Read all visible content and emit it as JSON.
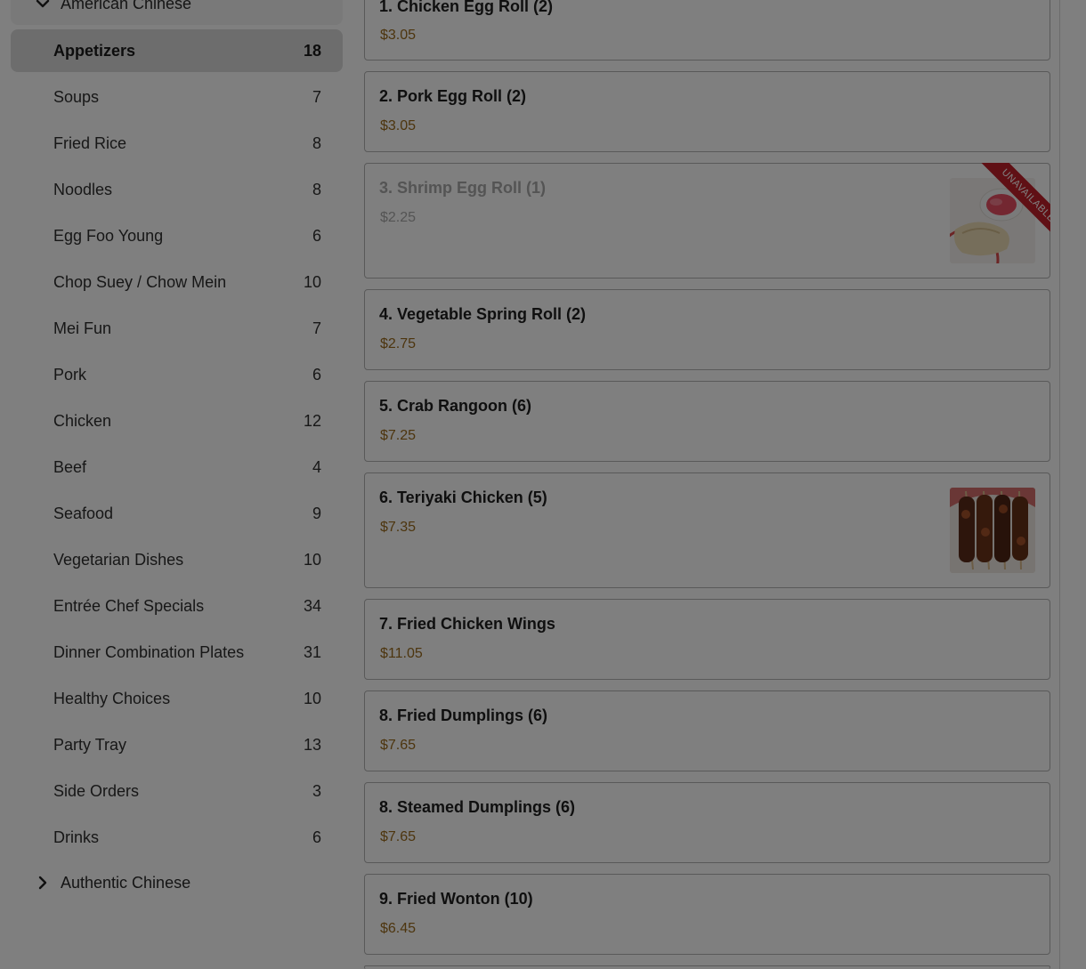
{
  "sidebar": {
    "groups": [
      {
        "label": "American Chinese",
        "expanded": true
      },
      {
        "label": "Authentic Chinese",
        "expanded": false
      }
    ],
    "categories": [
      {
        "label": "Appetizers",
        "count": "18"
      },
      {
        "label": "Soups",
        "count": "7"
      },
      {
        "label": "Fried Rice",
        "count": "8"
      },
      {
        "label": "Noodles",
        "count": "8"
      },
      {
        "label": "Egg Foo Young",
        "count": "6"
      },
      {
        "label": "Chop Suey / Chow Mein",
        "count": "10"
      },
      {
        "label": "Mei Fun",
        "count": "7"
      },
      {
        "label": "Pork",
        "count": "6"
      },
      {
        "label": "Chicken",
        "count": "12"
      },
      {
        "label": "Beef",
        "count": "4"
      },
      {
        "label": "Seafood",
        "count": "9"
      },
      {
        "label": "Vegetarian Dishes",
        "count": "10"
      },
      {
        "label": "Entrée Chef Specials",
        "count": "34"
      },
      {
        "label": "Dinner Combination Plates",
        "count": "31"
      },
      {
        "label": "Healthy Choices",
        "count": "10"
      },
      {
        "label": "Party Tray",
        "count": "13"
      },
      {
        "label": "Side Orders",
        "count": "3"
      },
      {
        "label": "Drinks",
        "count": "6"
      }
    ]
  },
  "menu": {
    "items": [
      {
        "name": "1. Chicken Egg Roll (2)",
        "price": "$3.05"
      },
      {
        "name": "2. Pork Egg Roll (2)",
        "price": "$3.05"
      },
      {
        "name": "3. Shrimp Egg Roll (1)",
        "price": "$2.25",
        "badge": "UNAVAILABLE",
        "image": "egg-roll-image"
      },
      {
        "name": "4. Vegetable Spring Roll (2)",
        "price": "$2.75"
      },
      {
        "name": "5. Crab Rangoon (6)",
        "price": "$7.25"
      },
      {
        "name": "6. Teriyaki Chicken (5)",
        "price": "$7.35",
        "image": "teriyaki-skewers-image"
      },
      {
        "name": "7. Fried Chicken Wings",
        "price": "$11.05"
      },
      {
        "name": "8. Fried Dumplings (6)",
        "price": "$7.65"
      },
      {
        "name": "8. Steamed Dumplings (6)",
        "price": "$7.65"
      },
      {
        "name": "9. Fried Wonton (10)",
        "price": "$6.45"
      }
    ]
  },
  "colors": {
    "price": "#9a6a1c",
    "unavailable_ribbon": "#c0202a",
    "active_category_bg": "#dadada",
    "overlay": "rgba(0,0,0,0.5)"
  }
}
